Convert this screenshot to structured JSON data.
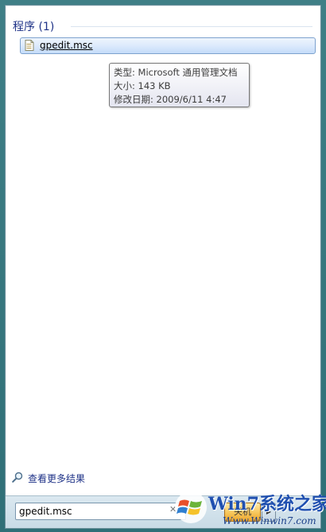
{
  "results": {
    "group_header": "程序 (1)",
    "items": [
      {
        "label": "gpedit.msc",
        "icon": "document-icon"
      }
    ]
  },
  "tooltip": {
    "type_line": "类型: Microsoft 通用管理文档",
    "size_line": "大小: 143 KB",
    "modified_line": "修改日期: 2009/6/11 4:47"
  },
  "see_more": {
    "label": "查看更多结果",
    "icon": "magnifier-icon"
  },
  "search": {
    "value": "gpedit.msc"
  },
  "shutdown": {
    "label": "关机"
  },
  "watermark": {
    "brand": "Win7系统之家",
    "url": "Www.Winwin7.com"
  },
  "colors": {
    "header_text": "#1e3287",
    "selection_border": "#7da2ce",
    "selection_fill": "#dceafc"
  }
}
